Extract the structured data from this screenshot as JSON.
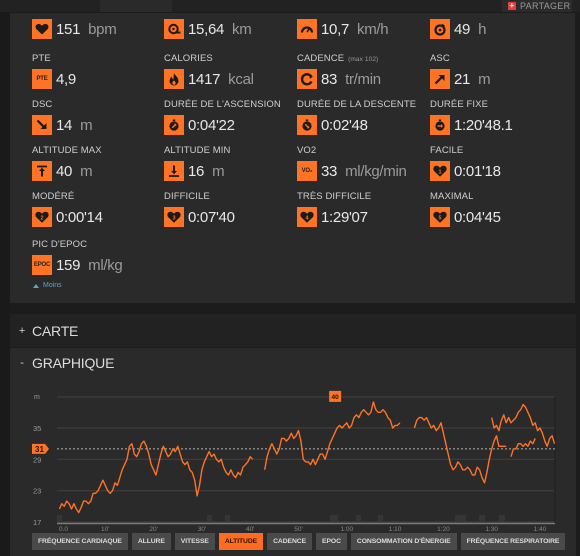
{
  "header": {
    "share_label": "PARTAGER",
    "share_icon": "plus-icon"
  },
  "stats": [
    {
      "id": "heart-rate",
      "label": "",
      "value": "151",
      "unit": "bpm",
      "icon": "heart-icon"
    },
    {
      "id": "distance",
      "label": "",
      "value": "15,64",
      "unit": "km",
      "icon": "distance-icon"
    },
    {
      "id": "speed",
      "label": "",
      "value": "10,7",
      "unit": "km/h",
      "icon": "speedometer-icon"
    },
    {
      "id": "recovery",
      "label": "",
      "value": "49",
      "unit": "h",
      "icon": "recovery-timer-icon"
    },
    {
      "id": "pte",
      "label": "PTE",
      "value": "4,9",
      "unit": "",
      "icon": "pte-icon",
      "icon_text": "PTE"
    },
    {
      "id": "calories",
      "label": "CALORIES",
      "value": "1417",
      "unit": "kcal",
      "icon": "flame-icon"
    },
    {
      "id": "cadence",
      "label": "CADENCE",
      "sublabel": "(max 102)",
      "value": "83",
      "unit": "tr/min",
      "icon": "cadence-icon"
    },
    {
      "id": "ascent",
      "label": "ASC",
      "value": "21",
      "unit": "m",
      "icon": "arrow-up-right-icon"
    },
    {
      "id": "descent",
      "label": "DSC",
      "value": "14",
      "unit": "m",
      "icon": "arrow-down-right-icon"
    },
    {
      "id": "ascent-time",
      "label": "DURÉE DE L'ASCENSION",
      "value": "0:04'22",
      "unit": "",
      "icon": "ascent-time-icon"
    },
    {
      "id": "descent-time",
      "label": "DURÉE DE LA DESCENTE",
      "value": "0:02'48",
      "unit": "",
      "icon": "descent-time-icon"
    },
    {
      "id": "flat-time",
      "label": "DURÉE FIXE",
      "value": "1:20'48.1",
      "unit": "",
      "icon": "flat-time-icon"
    },
    {
      "id": "alt-max",
      "label": "ALTITUDE MAX",
      "value": "40",
      "unit": "m",
      "icon": "altitude-max-icon"
    },
    {
      "id": "alt-min",
      "label": "ALTITUDE MIN",
      "value": "16",
      "unit": "m",
      "icon": "altitude-min-icon"
    },
    {
      "id": "vo2",
      "label": "VO2",
      "value": "33",
      "unit": "ml/kg/min",
      "icon": "vo2-icon",
      "icon_text": "VO₂"
    },
    {
      "id": "zone-easy",
      "label": "FACILE",
      "value": "0:01'18",
      "unit": "",
      "icon": "heart-zone-1-icon",
      "zone": "1"
    },
    {
      "id": "zone-moderate",
      "label": "MODÉRÉ",
      "value": "0:00'14",
      "unit": "",
      "icon": "heart-zone-2-icon",
      "zone": "2"
    },
    {
      "id": "zone-hard",
      "label": "DIFFICILE",
      "value": "0:07'40",
      "unit": "",
      "icon": "heart-zone-3-icon",
      "zone": "3"
    },
    {
      "id": "zone-very-hard",
      "label": "TRÈS DIFFICILE",
      "value": "1:29'07",
      "unit": "",
      "icon": "heart-zone-4-icon",
      "zone": "4"
    },
    {
      "id": "zone-max",
      "label": "MAXIMAL",
      "value": "0:04'45",
      "unit": "",
      "icon": "heart-zone-5-icon",
      "zone": "5"
    },
    {
      "id": "epoc",
      "label": "PIC D'EPOC",
      "value": "159",
      "unit": "ml/kg",
      "icon": "epoc-icon",
      "icon_text": "EPOC"
    }
  ],
  "less_link": "Moins",
  "sections": {
    "map": {
      "toggle": "+",
      "title": "CARTE"
    },
    "graph": {
      "toggle": "-",
      "title": "GRAPHIQUE"
    }
  },
  "chart_tabs": [
    {
      "label": "FRÉQUENCE CARDIAQUE",
      "active": false
    },
    {
      "label": "ALLURE",
      "active": false
    },
    {
      "label": "VITESSE",
      "active": false
    },
    {
      "label": "ALTITUDE",
      "active": true
    },
    {
      "label": "CADENCE",
      "active": false
    },
    {
      "label": "EPOC",
      "active": false
    },
    {
      "label": "CONSOMMATION D'ÉNERGIE",
      "active": false
    },
    {
      "label": "FRÉQUENCE RESPIRATOIRE",
      "active": false
    }
  ],
  "colors": {
    "accent": "#ff7324",
    "background": "#2a2a2a",
    "link": "#5aa6c4"
  },
  "chart_data": {
    "type": "line",
    "title": "Altitude",
    "ylabel": "m",
    "xlabel": "",
    "ylim": [
      17,
      41
    ],
    "xlim": [
      0,
      103
    ],
    "yticks": [
      17,
      23,
      29,
      35
    ],
    "ytick_labels": [
      "17",
      "23",
      "29",
      "35"
    ],
    "xticks": [
      0,
      10,
      20,
      30,
      40,
      50,
      60,
      70,
      80,
      90,
      100
    ],
    "xtick_labels": [
      "0.0",
      "10'",
      "20'",
      "30'",
      "40'",
      "50'",
      "1:00",
      "1:10",
      "1:20",
      "1:30",
      "1:40"
    ],
    "grid": true,
    "average": {
      "value": 31,
      "label": "31"
    },
    "max_marker": {
      "x": 58,
      "value": 40,
      "label": "40"
    },
    "series": [
      {
        "name": "Altitude",
        "segments": [
          [
            [
              0.5,
              19.5
            ],
            [
              1,
              20.5
            ],
            [
              1.5,
              20
            ],
            [
              2,
              21
            ],
            [
              2.5,
              20.5
            ],
            [
              3,
              19.5
            ],
            [
              3.5,
              20.5
            ],
            [
              4,
              19.5
            ],
            [
              4.5,
              18.8
            ],
            [
              5,
              19.8
            ],
            [
              5.5,
              21
            ],
            [
              6,
              21
            ],
            [
              6.5,
              20.5
            ],
            [
              7,
              21
            ],
            [
              7.5,
              22.5
            ],
            [
              8,
              22.5
            ],
            [
              8.5,
              23
            ],
            [
              9,
              24
            ],
            [
              9.5,
              25
            ],
            [
              10,
              24
            ],
            [
              10.5,
              23
            ],
            [
              11,
              22.5
            ],
            [
              11.5,
              23
            ],
            [
              12,
              24.5
            ],
            [
              12.5,
              24
            ],
            [
              13,
              25.5
            ],
            [
              13.5,
              27
            ],
            [
              14,
              28
            ],
            [
              14.5,
              29
            ],
            [
              15,
              31.5
            ],
            [
              15.5,
              32
            ],
            [
              16,
              30
            ],
            [
              16.5,
              29.5
            ],
            [
              17,
              30.5
            ],
            [
              17.5,
              32
            ],
            [
              18,
              32.5
            ],
            [
              18.5,
              31.5
            ],
            [
              19,
              30
            ],
            [
              19.5,
              28
            ],
            [
              20,
              27
            ],
            [
              20.5,
              26
            ],
            [
              21,
              28
            ],
            [
              21.5,
              30
            ],
            [
              22,
              31.5
            ],
            [
              22.5,
              30.5
            ],
            [
              23,
              29.5
            ],
            [
              23.5,
              30
            ],
            [
              24,
              31
            ],
            [
              24.5,
              30.5
            ],
            [
              25,
              31.5
            ],
            [
              25.5,
              30
            ],
            [
              26,
              28.5
            ],
            [
              26.5,
              28
            ],
            [
              27,
              28.5
            ],
            [
              27.5,
              27
            ],
            [
              28,
              26.5
            ],
            [
              28.5,
              25
            ],
            [
              29,
              22
            ],
            [
              29.5,
              24
            ],
            [
              30,
              27
            ],
            [
              30.5,
              28.5
            ],
            [
              31,
              29.5
            ],
            [
              31.5,
              30.5
            ],
            [
              32,
              29.5
            ],
            [
              32.5,
              30
            ],
            [
              33,
              29
            ],
            [
              33.5,
              28.5
            ],
            [
              34,
              29
            ],
            [
              34.5,
              27.5
            ],
            [
              35,
              26.5
            ],
            [
              35.5,
              26
            ],
            [
              36,
              27
            ],
            [
              36.5,
              26
            ],
            [
              37,
              25.5
            ],
            [
              37.5,
              26.5
            ],
            [
              38,
              26
            ],
            [
              38.5,
              27.5
            ],
            [
              39,
              28
            ],
            [
              39.5,
              28.5
            ],
            [
              40,
              29.5
            ],
            [
              40.5,
              29
            ]
          ],
          [
            [
              43,
              27
            ],
            [
              43.5,
              29.5
            ],
            [
              44,
              31
            ],
            [
              44.5,
              32
            ],
            [
              45,
              31
            ],
            [
              45.5,
              30
            ],
            [
              46,
              31
            ],
            [
              46.5,
              33
            ],
            [
              47,
              33
            ],
            [
              47.5,
              32.5
            ],
            [
              48,
              33
            ],
            [
              48.5,
              34
            ],
            [
              49,
              33
            ],
            [
              49.5,
              33.5
            ],
            [
              50,
              34.5
            ],
            [
              50.5,
              32.5
            ],
            [
              51,
              29
            ],
            [
              51.5,
              28.5
            ],
            [
              52,
              28.5
            ],
            [
              52.5,
              28
            ],
            [
              53,
              29
            ],
            [
              53.5,
              28
            ],
            [
              54,
              29
            ],
            [
              54.5,
              30
            ],
            [
              55,
              30
            ],
            [
              55.5,
              29
            ],
            [
              56,
              30.5
            ],
            [
              56.5,
              32
            ],
            [
              57,
              33
            ],
            [
              57.5,
              34
            ],
            [
              58,
              35
            ],
            [
              58.5,
              35.5
            ],
            [
              59,
              35
            ],
            [
              59.5,
              35.5
            ],
            [
              60,
              36
            ],
            [
              60.5,
              35
            ],
            [
              61,
              35.5
            ],
            [
              61.5,
              37
            ],
            [
              62,
              37.5
            ],
            [
              62.5,
              37
            ],
            [
              63,
              38
            ],
            [
              63.5,
              38.5
            ],
            [
              64,
              38
            ],
            [
              64.5,
              37.5
            ],
            [
              65,
              38
            ],
            [
              65.5,
              40
            ],
            [
              66,
              38.5
            ],
            [
              66.5,
              38
            ],
            [
              67,
              38
            ],
            [
              67.5,
              38.5
            ],
            [
              68,
              38
            ],
            [
              68.5,
              37
            ],
            [
              69,
              36.5
            ],
            [
              69.5,
              35
            ],
            [
              70,
              35.5
            ],
            [
              70.5,
              35.5
            ],
            [
              71,
              36
            ]
          ],
          [
            [
              74,
              35
            ],
            [
              74.5,
              36.5
            ],
            [
              75,
              37
            ],
            [
              75.5,
              37
            ],
            [
              76,
              36.5
            ],
            [
              76.5,
              37
            ],
            [
              77,
              36
            ],
            [
              77.5,
              35
            ],
            [
              78,
              35.5
            ],
            [
              78.5,
              34.5
            ],
            [
              79,
              35
            ],
            [
              79.5,
              36
            ],
            [
              80,
              34
            ],
            [
              80.5,
              32
            ],
            [
              81,
              30
            ],
            [
              81.5,
              28
            ],
            [
              82,
              27
            ],
            [
              82.5,
              27.5
            ],
            [
              83,
              28.5
            ],
            [
              83.5,
              28
            ],
            [
              84,
              27
            ],
            [
              84.5,
              27
            ],
            [
              85,
              27.5
            ],
            [
              85.5,
              27
            ],
            [
              86,
              26
            ],
            [
              86.5,
              26
            ],
            [
              87,
              27.5
            ],
            [
              87.5,
              27
            ],
            [
              88,
              25.5
            ],
            [
              88.5,
              24.5
            ],
            [
              89,
              26.5
            ],
            [
              89.5,
              29
            ],
            [
              90,
              31
            ],
            [
              90.5,
              32.5
            ],
            [
              91,
              33.5
            ],
            [
              91.5,
              31.5
            ],
            [
              92,
              31.5
            ],
            [
              93,
              31.5
            ]
          ],
          [
            [
              94,
              29.5
            ],
            [
              94.5,
              31
            ],
            [
              95,
              31
            ],
            [
              95.5,
              32
            ],
            [
              96,
              32
            ],
            [
              96.5,
              31.5
            ],
            [
              97,
              32
            ],
            [
              97.5,
              31.5
            ],
            [
              98,
              32.5
            ],
            [
              98.5,
              32
            ],
            [
              99,
              33
            ]
          ],
          [
            [
              90,
              37
            ],
            [
              90.5,
              35
            ],
            [
              91,
              35.5
            ],
            [
              91.5,
              34.5
            ],
            [
              92,
              36.5
            ],
            [
              92.5,
              37.5
            ],
            [
              93,
              36
            ],
            [
              93.5,
              37
            ],
            [
              94,
              36
            ],
            [
              94.5,
              36.5
            ],
            [
              95,
              37
            ],
            [
              95.5,
              38
            ],
            [
              96,
              38.5
            ],
            [
              96.5,
              39.5
            ],
            [
              97,
              39
            ],
            [
              97.5,
              38
            ],
            [
              98,
              37
            ],
            [
              98.5,
              35.5
            ],
            [
              99,
              36
            ],
            [
              99.5,
              34.5
            ],
            [
              100,
              35
            ],
            [
              100.5,
              34
            ],
            [
              101,
              32.5
            ],
            [
              101.5,
              31.5
            ],
            [
              102,
              33
            ],
            [
              102.5,
              33.5
            ],
            [
              103,
              32
            ]
          ]
        ]
      }
    ]
  }
}
